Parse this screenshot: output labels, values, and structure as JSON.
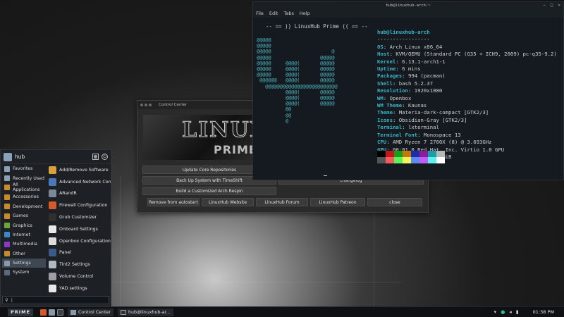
{
  "control_center": {
    "title": "Control Center",
    "banner_logo": "LINUX",
    "banner_sub": "PRIME",
    "buttons": {
      "update": "Update Core Repositories",
      "backup": "Back Up System with TimeShift",
      "changelog": "changelog",
      "respin": "Build a Customized Arch Respin",
      "autostart": "Remove from autostart",
      "website": "LinuxHub Website",
      "forum": "LinuxHub Forum",
      "patreon": "LinuxHub Patreon",
      "close": "close"
    }
  },
  "terminal": {
    "title": "hub@linuxhub-arch:~",
    "menu": [
      "File",
      "Edit",
      "Tabs",
      "Help"
    ],
    "header": "-- == )) LinuxHub Prime (( == --",
    "art": "@@@@@\n@@@@@\n@@@@@                     @\n@@@@@                 @@@@@\n@@@@@     @@@@(       @@@@@\n@@@@@     @@@@(       @@@@@\n@@@@@     @@@@(       @@@@@\n @@@@@@   @@@@(       @@@@@\n   @@@@@@@@@@@@@@@@@@@@@@@@@\n          @@@@(       @@@@@\n          @@@@(       @@@@@\n          @@@@(       @@@@@\n          @@\n          @@\n          @",
    "user_host": "hub@linuxhub-arch",
    "separator": "-----------------",
    "info": [
      {
        "key": "OS",
        "value": "Arch Linux x86_64"
      },
      {
        "key": "Host",
        "value": "KVM/QEMU (Standard PC (Q35 + ICH9, 2009) pc-q35-9.2)"
      },
      {
        "key": "Kernel",
        "value": "6.13.1-arch1-1"
      },
      {
        "key": "Uptime",
        "value": "6 mins"
      },
      {
        "key": "Packages",
        "value": "994 (pacman)"
      },
      {
        "key": "Shell",
        "value": "bash 5.2.37"
      },
      {
        "key": "Resolution",
        "value": "1920x1080"
      },
      {
        "key": "WM",
        "value": "Openbox"
      },
      {
        "key": "WM Theme",
        "value": "Kaunas"
      },
      {
        "key": "Theme",
        "value": "Materia-dark-compact [GTK2/3]"
      },
      {
        "key": "Icons",
        "value": "Obsidian-Gray [GTK2/3]"
      },
      {
        "key": "Terminal",
        "value": "lxterminal"
      },
      {
        "key": "Terminal Font",
        "value": "Monospace 13"
      },
      {
        "key": "CPU",
        "value": "AMD Ryzen 7 2700X (8) @ 3.693GHz"
      },
      {
        "key": "GPU",
        "value": "00:01.0 Red Hat, Inc. Virtio 1.0 GPU"
      },
      {
        "key": "Memory",
        "value": "347MiB / 3913MiB"
      }
    ],
    "palette_row1": [
      "#000000",
      "#c4161c",
      "#16a016",
      "#c47a0a",
      "#1c2fa8",
      "#8a1c9e",
      "#1c9ea8",
      "#b8b8b8"
    ],
    "palette_row2": [
      "#555555",
      "#f25c5c",
      "#5cf25c",
      "#f2f25c",
      "#5c8af2",
      "#c25cf2",
      "#5cf2f2",
      "#ffffff"
    ]
  },
  "menu": {
    "username": "hub",
    "categories": [
      {
        "label": "Favorites",
        "color": "#8aa0b6"
      },
      {
        "label": "Recently Used",
        "color": "#8aa0b6"
      },
      {
        "label": "All Applications",
        "color": "#c98a2a"
      },
      {
        "label": "Accessories",
        "color": "#c98a2a"
      },
      {
        "label": "Development",
        "color": "#c98a2a"
      },
      {
        "label": "Games",
        "color": "#c98a2a"
      },
      {
        "label": "Graphics",
        "color": "#6aa83a"
      },
      {
        "label": "Internet",
        "color": "#3a8ac9"
      },
      {
        "label": "Multimedia",
        "color": "#8a3ac9"
      },
      {
        "label": "Other",
        "color": "#c98a2a"
      },
      {
        "label": "Settings",
        "color": "#8a98a8"
      },
      {
        "label": "System",
        "color": "#5a6a7a"
      }
    ],
    "selected_category": "Settings",
    "apps": [
      {
        "label": "Add/Remove Software",
        "color": "#d8a23a"
      },
      {
        "label": "Advanced Network Con...",
        "color": "#4a78b8"
      },
      {
        "label": "ARandR",
        "color": "#7a8898"
      },
      {
        "label": "Firewall Configuration",
        "color": "#d8582a"
      },
      {
        "label": "Grub Customizer",
        "color": "#303030"
      },
      {
        "label": "Onboard Settings",
        "color": "#e8e8e8"
      },
      {
        "label": "Openbox Configuration...",
        "color": "#dcdcdc"
      },
      {
        "label": "Panel",
        "color": "#3a5a8a"
      },
      {
        "label": "Tint2 Settings",
        "color": "#b0b8c0"
      },
      {
        "label": "Volume Control",
        "color": "#9aa0a6"
      },
      {
        "label": "YAD settings",
        "color": "#e8e8e8"
      }
    ],
    "search_value": ""
  },
  "taskbar": {
    "start_label": "PRIME",
    "tasks": [
      {
        "label": "Control Center"
      },
      {
        "label": "hub@linuxhub-ar..."
      }
    ],
    "clock": "01:38 PM"
  }
}
